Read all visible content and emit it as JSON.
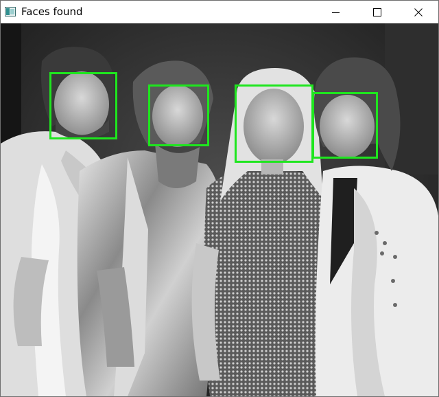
{
  "window": {
    "title": "Faces found",
    "icons": {
      "app": "image-window-icon",
      "minimize": "minimize-icon",
      "maximize": "maximize-icon",
      "close": "close-icon"
    }
  },
  "image": {
    "description_type": "grayscale-photo",
    "detections": [
      {
        "label": "face",
        "color": "#1ee61e"
      },
      {
        "label": "face",
        "color": "#1ee61e"
      },
      {
        "label": "face",
        "color": "#1ee61e"
      },
      {
        "label": "face",
        "color": "#1ee61e"
      }
    ]
  }
}
